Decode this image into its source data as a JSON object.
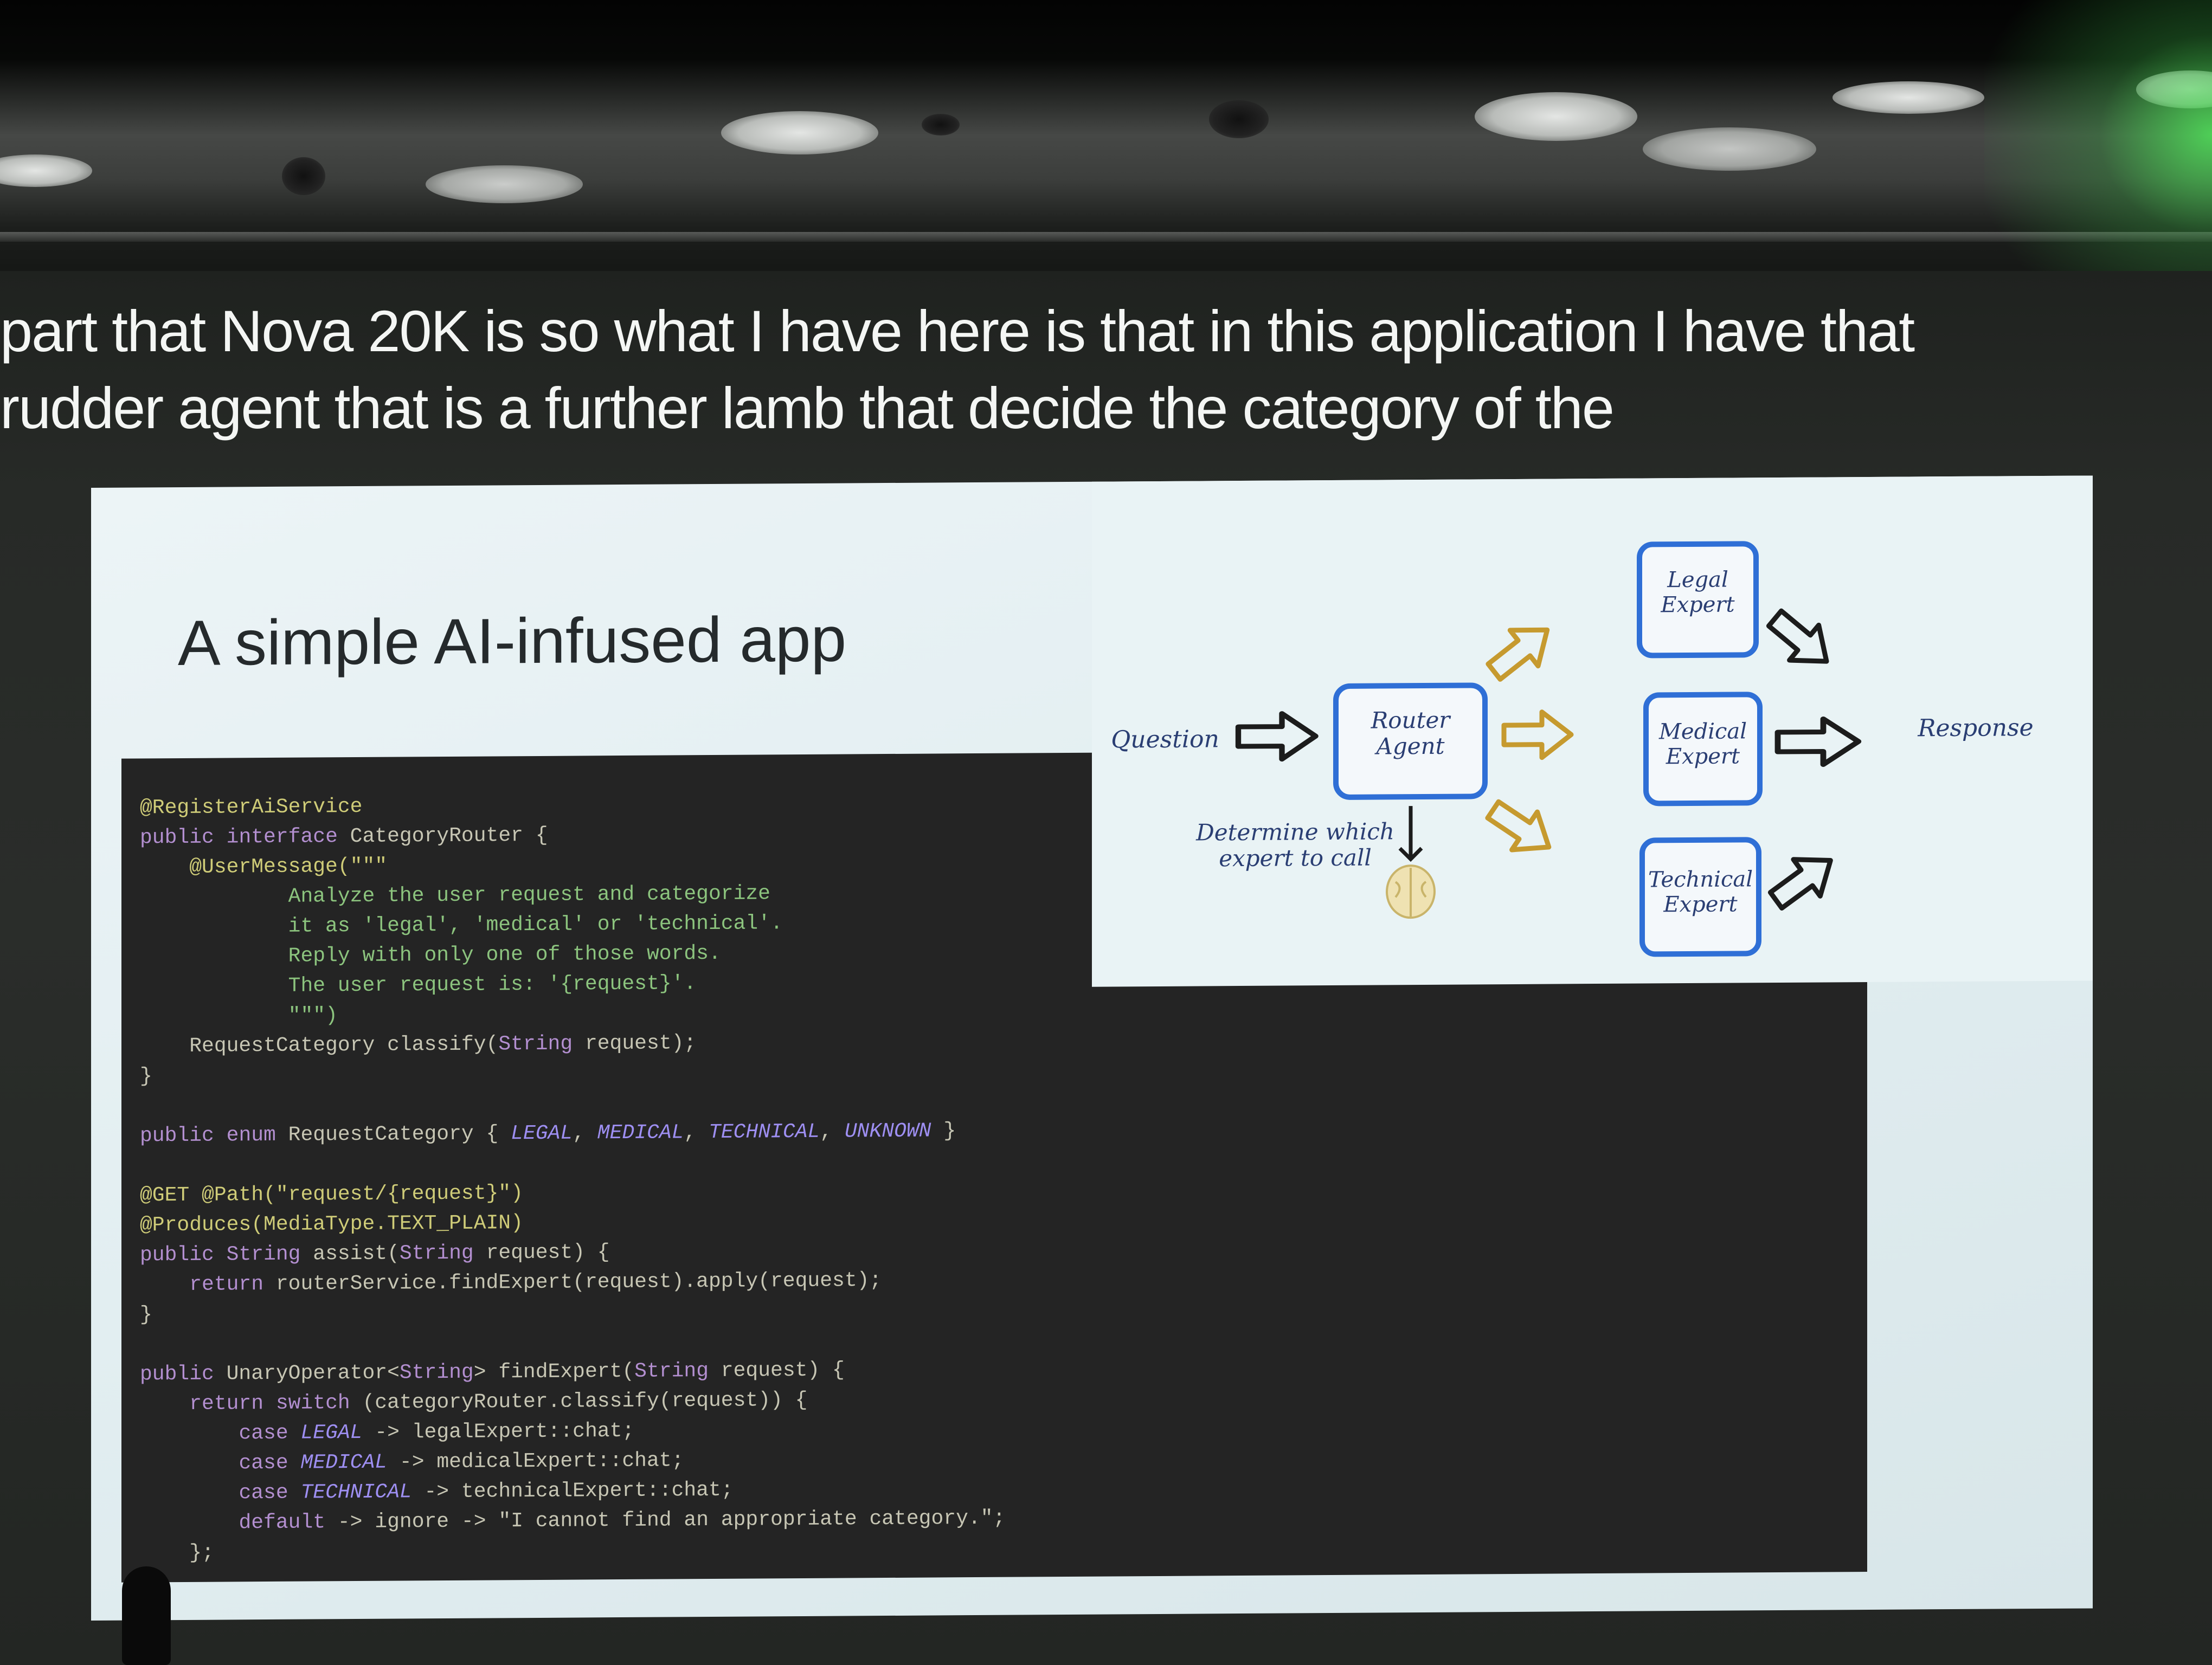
{
  "caption": {
    "line1": "part that Nova 20K is so what I have here is that in this application I have that",
    "line2": "rudder agent that is a further lamb that decide the category of the"
  },
  "slide": {
    "title": "A simple AI-infused app",
    "code": [
      "@RegisterAiService",
      "public interface CategoryRouter {",
      "    @UserMessage(\"\"\"",
      "            Analyze the user request and categorize",
      "            it as 'legal', 'medical' or 'technical'.",
      "            Reply with only one of those words.",
      "            The user request is: '{request}'.",
      "            \"\"\")",
      "    RequestCategory classify(String request);",
      "}",
      "",
      "public enum RequestCategory { LEGAL, MEDICAL, TECHNICAL, UNKNOWN }",
      "",
      "@GET @Path(\"request/{request}\")",
      "@Produces(MediaType.TEXT_PLAIN)",
      "public String assist(String request) {",
      "    return routerService.findExpert(request).apply(request);",
      "}",
      "",
      "public UnaryOperator<String> findExpert(String request) {",
      "    return switch (categoryRouter.classify(request)) {",
      "        case LEGAL -> legalExpert::chat;",
      "        case MEDICAL -> medicalExpert::chat;",
      "        case TECHNICAL -> technicalExpert::chat;",
      "        default -> ignore -> \"I cannot find an appropriate category.\";",
      "    };"
    ],
    "diagram": {
      "question": "Question",
      "router_line1": "Router",
      "router_line2": "Agent",
      "determine_line1": "Determine which",
      "determine_line2": "expert to call",
      "legal_line1": "Legal",
      "legal_line2": "Expert",
      "medical_line1": "Medical",
      "medical_line2": "Expert",
      "technical_line1": "Technical",
      "technical_line2": "Expert",
      "response": "Response",
      "box_color": "#2f6fd6",
      "arrow_color_routing": "#c69a2f",
      "arrow_color_flow": "#1c1c1c"
    }
  }
}
